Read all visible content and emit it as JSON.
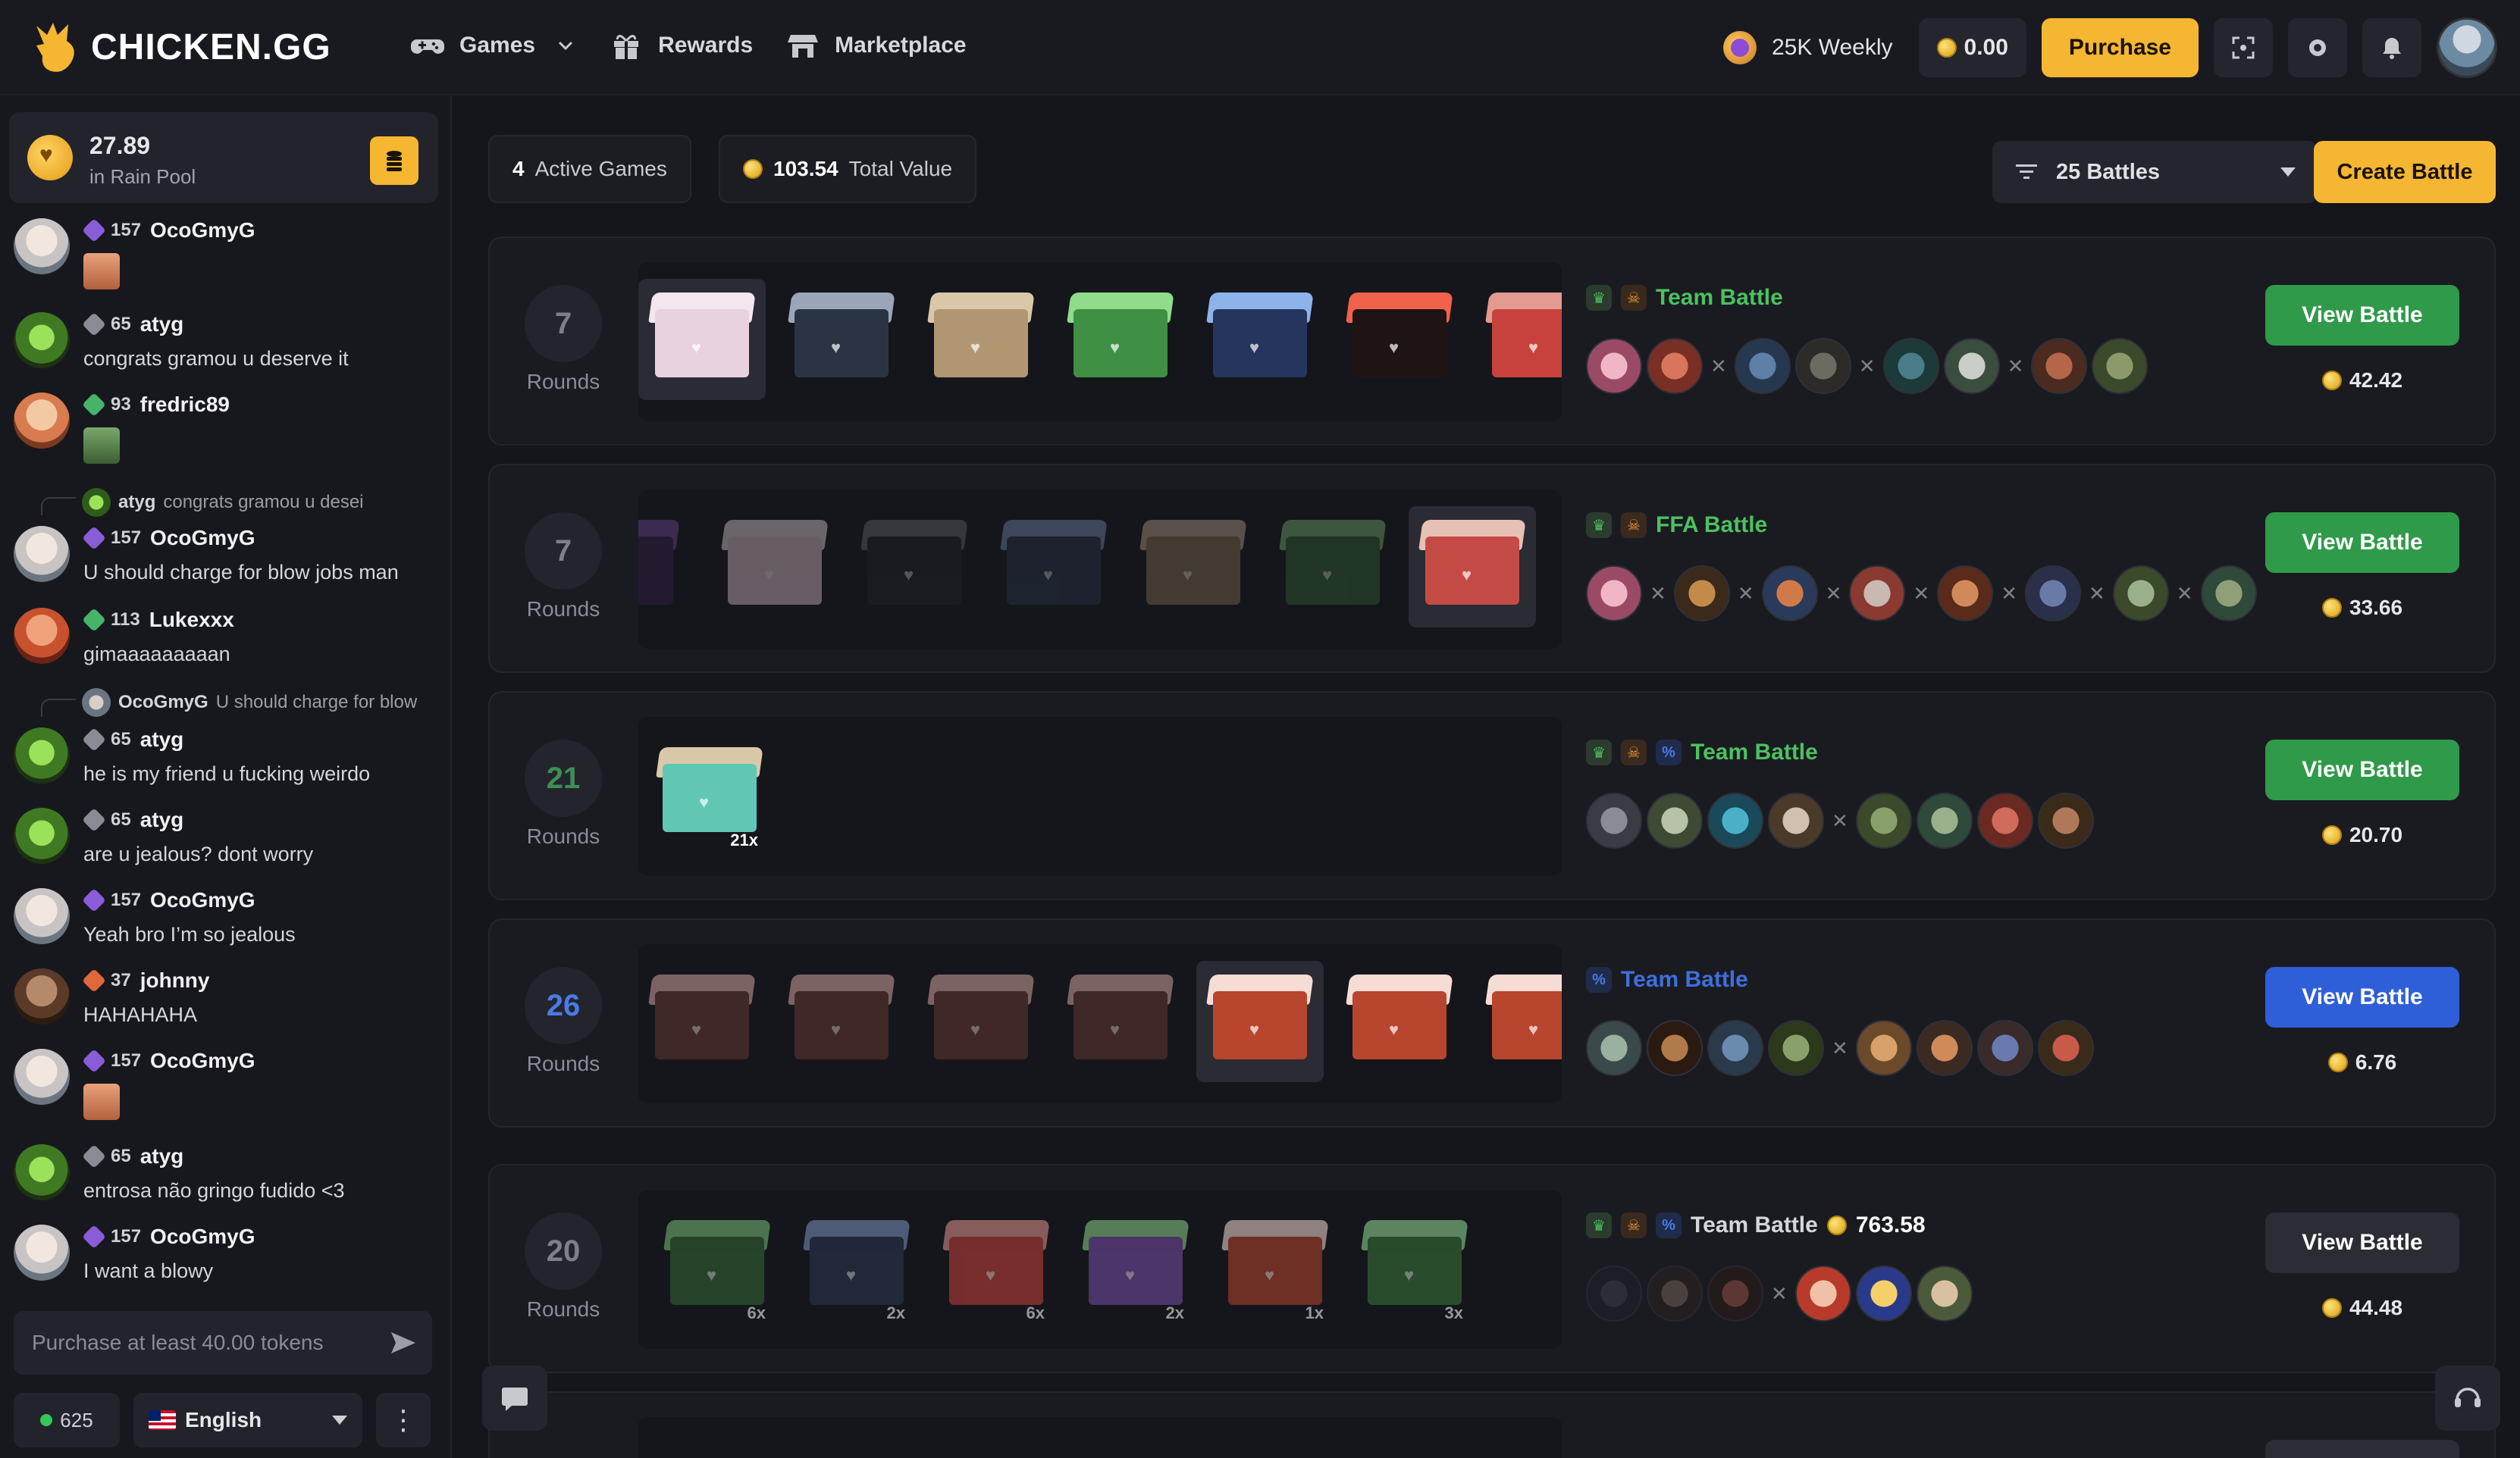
{
  "header": {
    "logo_text": "CHICKEN.GG",
    "nav": [
      {
        "label": "Games",
        "icon": "gamepad-icon",
        "has_dropdown": true
      },
      {
        "label": "Rewards",
        "icon": "gift-icon"
      },
      {
        "label": "Marketplace",
        "icon": "store-icon"
      }
    ],
    "weekly_label": "25K Weekly",
    "balance": "0.00",
    "purchase_label": "Purchase"
  },
  "sidebar": {
    "rain_amount": "27.89",
    "rain_label": "in Rain Pool",
    "messages": [
      {
        "level": "157",
        "user": "OcoGmyG",
        "text": "",
        "emote": true
      },
      {
        "level": "65",
        "user": "atyg",
        "text": "congrats gramou u deserve it"
      },
      {
        "level": "93",
        "user": "fredric89",
        "text": "",
        "emote": true
      },
      {
        "reply_user": "atyg",
        "reply_text": "congrats gramou u desei",
        "level": "157",
        "user": "OcoGmyG",
        "text": "U should charge for blow jobs man"
      },
      {
        "level": "113",
        "user": "Lukexxx",
        "text": "gimaaaaaaaaan"
      },
      {
        "reply_user": "OcoGmyG",
        "reply_text": "U should charge for blow",
        "level": "65",
        "user": "atyg",
        "text": "he is my friend u fucking weirdo"
      },
      {
        "level": "65",
        "user": "atyg",
        "text": "are u jealous? dont worry"
      },
      {
        "level": "157",
        "user": "OcoGmyG",
        "text": "Yeah bro I’m so jealous"
      },
      {
        "level": "37",
        "user": "johnny",
        "text": "HAHAHAHA"
      },
      {
        "level": "157",
        "user": "OcoGmyG",
        "text": "",
        "emote": true
      },
      {
        "level": "65",
        "user": "atyg",
        "text": "entrosa não gringo fudido <3"
      },
      {
        "level": "157",
        "user": "OcoGmyG",
        "text": "I want a blowy"
      }
    ],
    "input_placeholder": "Purchase at least 40.00 tokens",
    "online_count": "625",
    "language": "English"
  },
  "main": {
    "active_games_count": "4",
    "active_games_label": "Active Games",
    "total_value": "103.54",
    "total_value_label": "Total Value",
    "filter_label": "25 Battles",
    "create_label": "Create Battle",
    "battles": [
      {
        "rounds": "7",
        "rounds_label": "Rounds",
        "mode": "Team Battle",
        "mode_color": "#4cc160",
        "value": "42.42",
        "view_label": "View Battle",
        "view_color": "#2f9a49"
      },
      {
        "rounds": "7",
        "rounds_label": "Rounds",
        "mode": "FFA Battle",
        "mode_color": "#4cc160",
        "value": "33.66",
        "view_label": "View Battle",
        "view_color": "#2f9a49"
      },
      {
        "rounds": "21",
        "rounds_label": "Rounds",
        "mode": "Team Battle",
        "mode_color": "#4cc160",
        "value": "20.70",
        "view_label": "View Battle",
        "view_color": "#2f9a49",
        "case_mult": "21x"
      },
      {
        "rounds": "26",
        "rounds_label": "Rounds",
        "mode": "Team Battle",
        "mode_color": "#3d6fe0",
        "value": "6.76",
        "view_label": "View Battle",
        "view_color": "#2f5fd8"
      },
      {
        "rounds": "20",
        "rounds_label": "Rounds",
        "mode": "Team Battle",
        "mode_color": "#d5d6da",
        "mode_value": "763.58",
        "value": "44.48",
        "view_label": "View Battle",
        "view_color": "#2b2c34",
        "mults": [
          "6x",
          "2x",
          "6x",
          "2x",
          "1x",
          "3x"
        ]
      }
    ]
  }
}
